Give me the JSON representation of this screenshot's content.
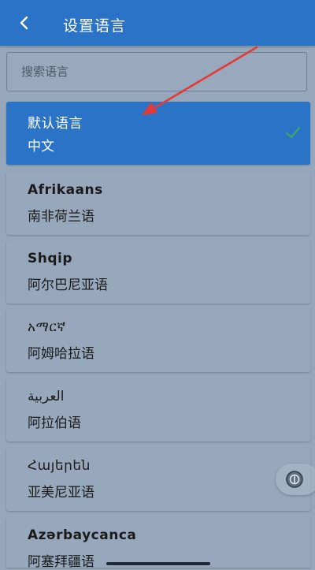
{
  "header": {
    "title": "设置语言",
    "back_icon": "back-arrow-icon"
  },
  "search": {
    "placeholder": "搜索语言",
    "value": ""
  },
  "languages": [
    {
      "native": "默认语言",
      "chinese": "中文",
      "selected": true
    },
    {
      "native": "Afrikaans",
      "chinese": "南非荷兰语",
      "selected": false
    },
    {
      "native": "Shqip",
      "chinese": "阿尔巴尼亚语",
      "selected": false
    },
    {
      "native": "አማርኛ",
      "chinese": "阿姆哈拉语",
      "selected": false
    },
    {
      "native": "العربية",
      "chinese": "阿拉伯语",
      "selected": false
    },
    {
      "native": "Հայերեն",
      "chinese": "亚美尼亚语",
      "selected": false
    },
    {
      "native": "Azərbaycanca",
      "chinese": "阿塞拜疆语",
      "selected": false
    }
  ],
  "colors": {
    "accent": "#2a73c7",
    "list_background": "#96a7bb",
    "check_color": "#3fa66a",
    "annotation_arrow": "#e53935"
  },
  "icons": {
    "selected_check": "check-icon",
    "floating_button": "floating-assist-icon"
  }
}
